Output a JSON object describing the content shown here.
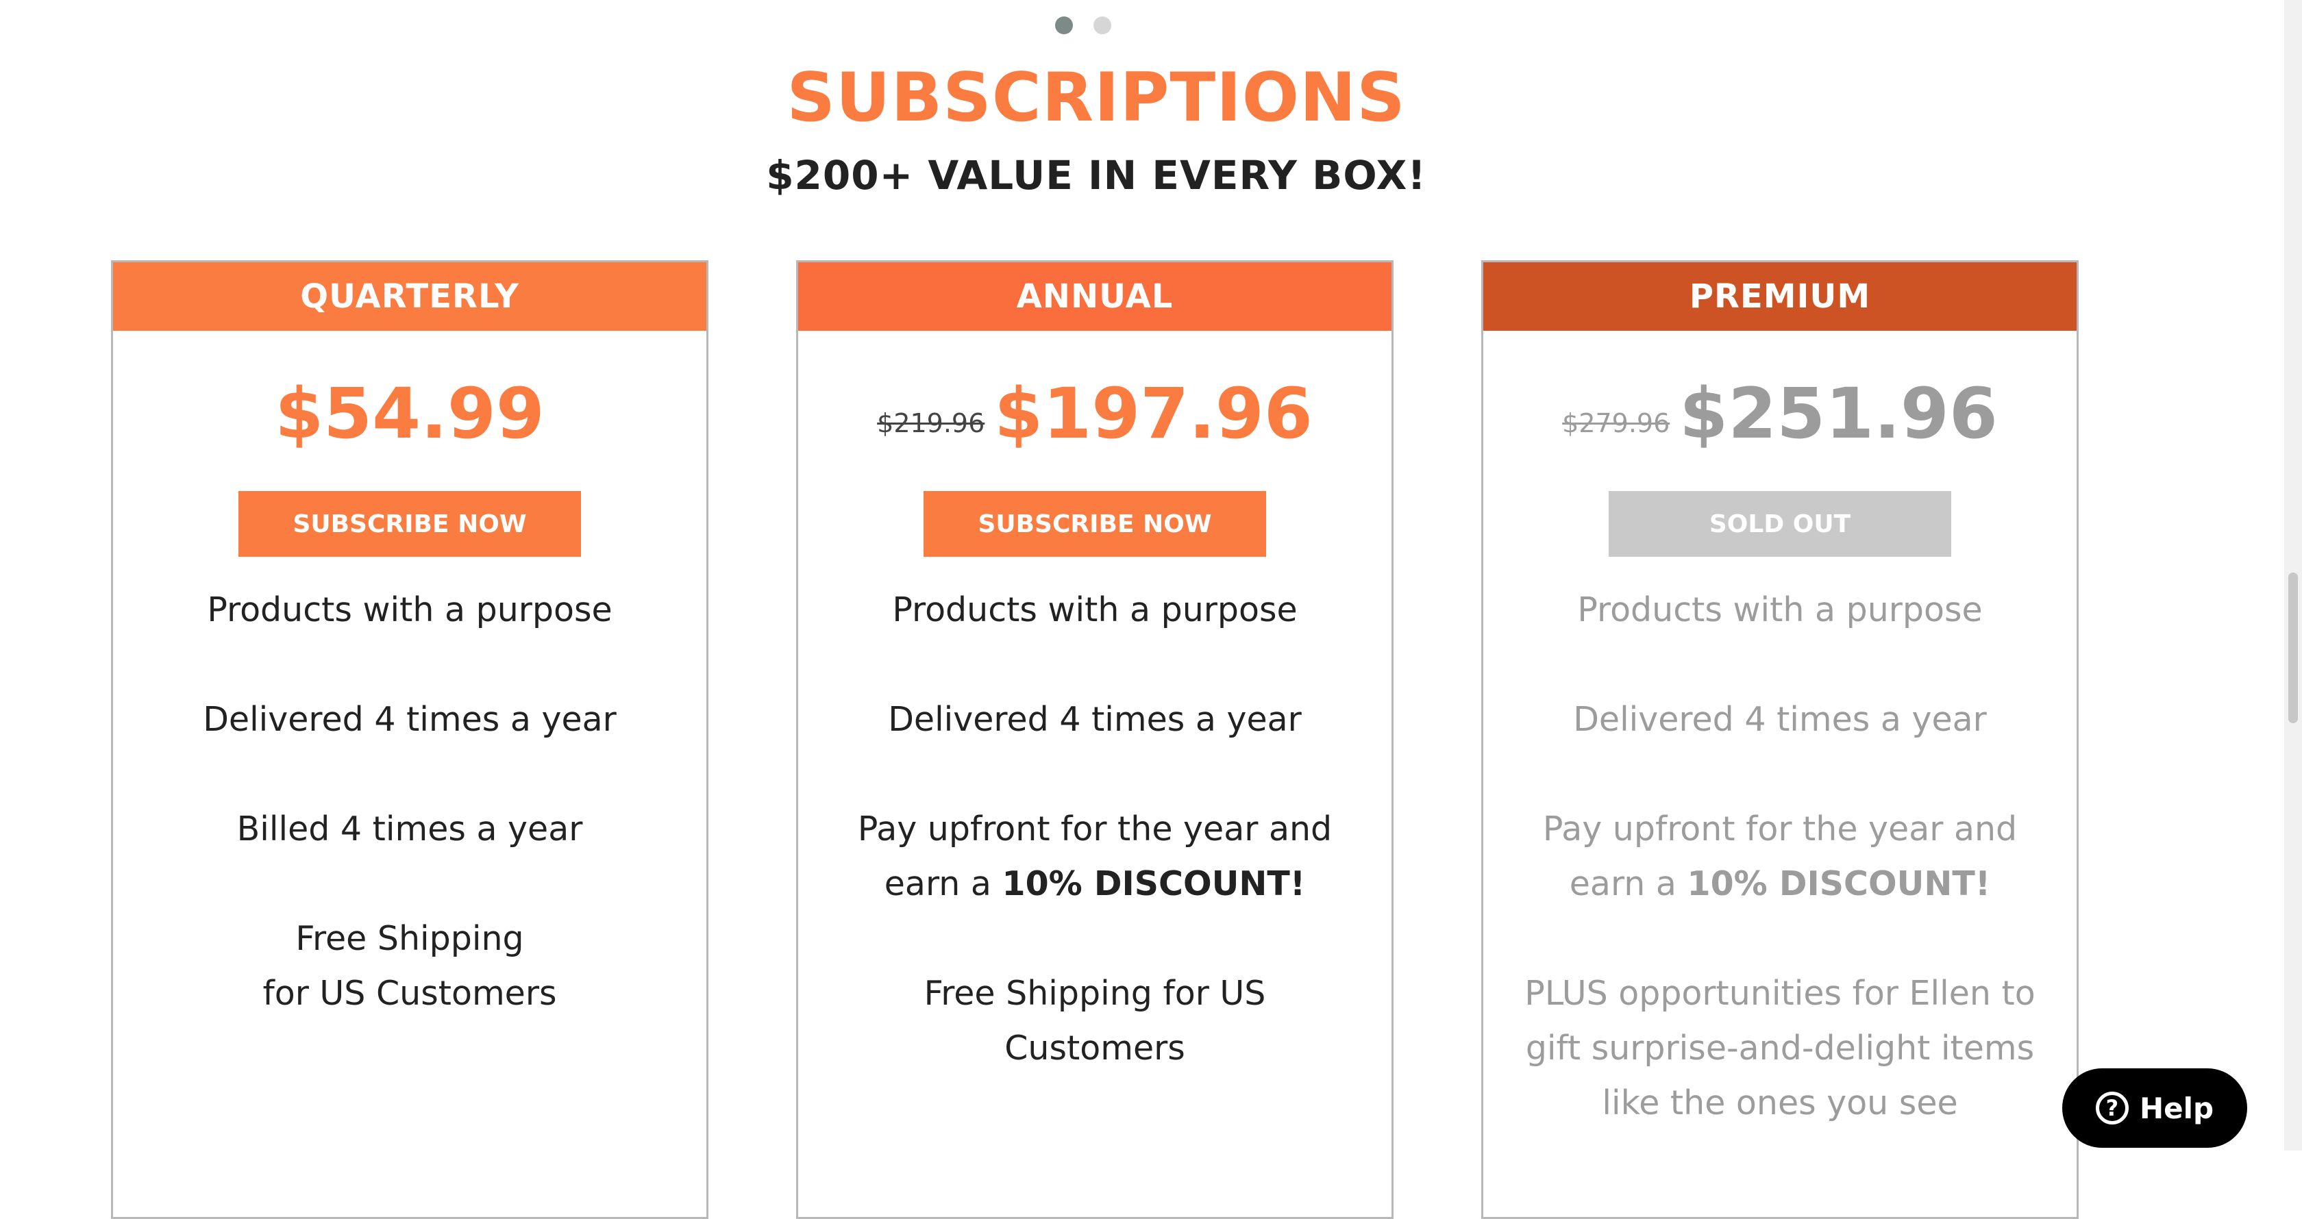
{
  "carousel": {
    "dots": 2,
    "active": 0
  },
  "section": {
    "title": "SUBSCRIPTIONS",
    "subtitle": "$200+ VALUE IN EVERY BOX!"
  },
  "plans": [
    {
      "name": "QUARTERLY",
      "header_color": "#FB7C40",
      "old_price": "",
      "price": "$54.99",
      "button_label": "SUBSCRIBE NOW",
      "button_state": "active",
      "features": [
        "Products with a purpose",
        "Delivered 4 times a year",
        "Billed 4 times a year",
        "Free Shipping\nfor US Customers"
      ]
    },
    {
      "name": "ANNUAL",
      "header_color": "#F96E3C",
      "old_price": "$219.96",
      "price": "$197.96",
      "button_label": "SUBSCRIBE NOW",
      "button_state": "active",
      "features": [
        "Products with a purpose",
        "Delivered 4 times a year",
        "Pay upfront for the year and earn a",
        "Free Shipping for US Customers"
      ],
      "discount_text": "10% DISCOUNT!"
    },
    {
      "name": "PREMIUM",
      "header_color": "#CD5324",
      "old_price": "$279.96",
      "price": "$251.96",
      "button_label": "SOLD OUT",
      "button_state": "disabled",
      "features": [
        "Products with a purpose",
        "Delivered 4 times a year",
        "Pay upfront for the year and earn a",
        "PLUS opportunities for Ellen to gift surprise-and-delight items like the ones you see"
      ],
      "discount_text": "10% DISCOUNT!"
    }
  ],
  "help": {
    "label": "Help",
    "icon": "question-circle-icon"
  },
  "colors": {
    "accent": "#FB7C40",
    "disabled": "#C9C9C9",
    "muted_text": "#9C9C9C"
  }
}
